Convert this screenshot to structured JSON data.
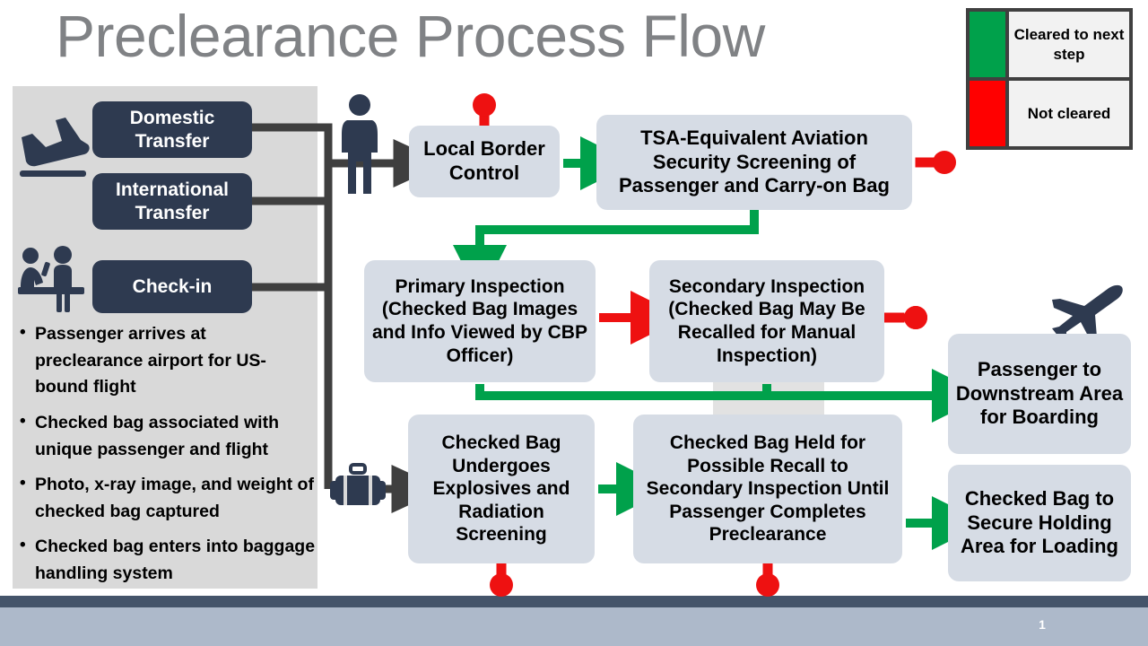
{
  "slide": {
    "title": "Preclearance Process Flow",
    "page_number": "1"
  },
  "colors": {
    "title_gray": "#808285",
    "cleared_green": "#00a14b",
    "not_cleared_red": "#ff0000",
    "navy_box": "#2e3a50",
    "process_box": "#d6dce5",
    "panel_gray": "#d9d9d9",
    "footer_dark": "#44546a",
    "footer_light": "#adb9ca",
    "connector_dark": "#3f3f3f"
  },
  "legend": {
    "rows": [
      {
        "swatch": "green",
        "label": "Cleared to next step"
      },
      {
        "swatch": "red",
        "label": "Not cleared"
      }
    ]
  },
  "left_panel": {
    "entry_boxes": [
      {
        "id": "domestic",
        "label": "Domestic Transfer"
      },
      {
        "id": "international",
        "label": "International Transfer"
      },
      {
        "id": "checkin",
        "label": "Check-in"
      }
    ],
    "icons": [
      {
        "name": "airplane-landing-icon"
      },
      {
        "name": "check-in-counter-icon"
      }
    ],
    "bullets": [
      "Passenger arrives at preclearance airport for  US-bound flight",
      "Checked bag associated with unique passenger and flight",
      "Photo, x-ray image, and weight of checked bag captured",
      "Checked bag enters into baggage handling system"
    ]
  },
  "flow": {
    "boxes": [
      {
        "id": "local_border_control",
        "label": "Local Border Control"
      },
      {
        "id": "tsa_screening",
        "label": "TSA-Equivalent Aviation Security Screening of Passenger and Carry-on Bag"
      },
      {
        "id": "primary_inspection",
        "label": "Primary Inspection (Checked Bag Images and Info Viewed by CBP Officer)"
      },
      {
        "id": "secondary_inspection",
        "label": "Secondary Inspection (Checked Bag May Be Recalled for Manual Inspection)"
      },
      {
        "id": "passenger_downstream",
        "label": "Passenger to Downstream Area for Boarding"
      },
      {
        "id": "checked_bag_screening",
        "label": "Checked Bag Undergoes Explosives and Radiation Screening"
      },
      {
        "id": "checked_bag_held",
        "label": "Checked Bag Held for Possible Recall to Secondary Inspection Until Passenger Completes Preclearance"
      },
      {
        "id": "checked_bag_secure",
        "label": "Checked Bag to Secure Holding Area for Loading"
      }
    ],
    "icons": [
      {
        "name": "passenger-icon"
      },
      {
        "name": "suitcase-icon"
      },
      {
        "name": "airplane-departing-icon"
      }
    ],
    "not_cleared_markers": [
      {
        "at": "local_border_control",
        "orientation": "top"
      },
      {
        "at": "tsa_screening",
        "orientation": "right"
      },
      {
        "at": "primary_inspection",
        "orientation": "right"
      },
      {
        "at": "secondary_inspection",
        "orientation": "right"
      },
      {
        "at": "checked_bag_screening",
        "orientation": "bottom"
      },
      {
        "at": "checked_bag_held",
        "orientation": "bottom"
      }
    ]
  }
}
